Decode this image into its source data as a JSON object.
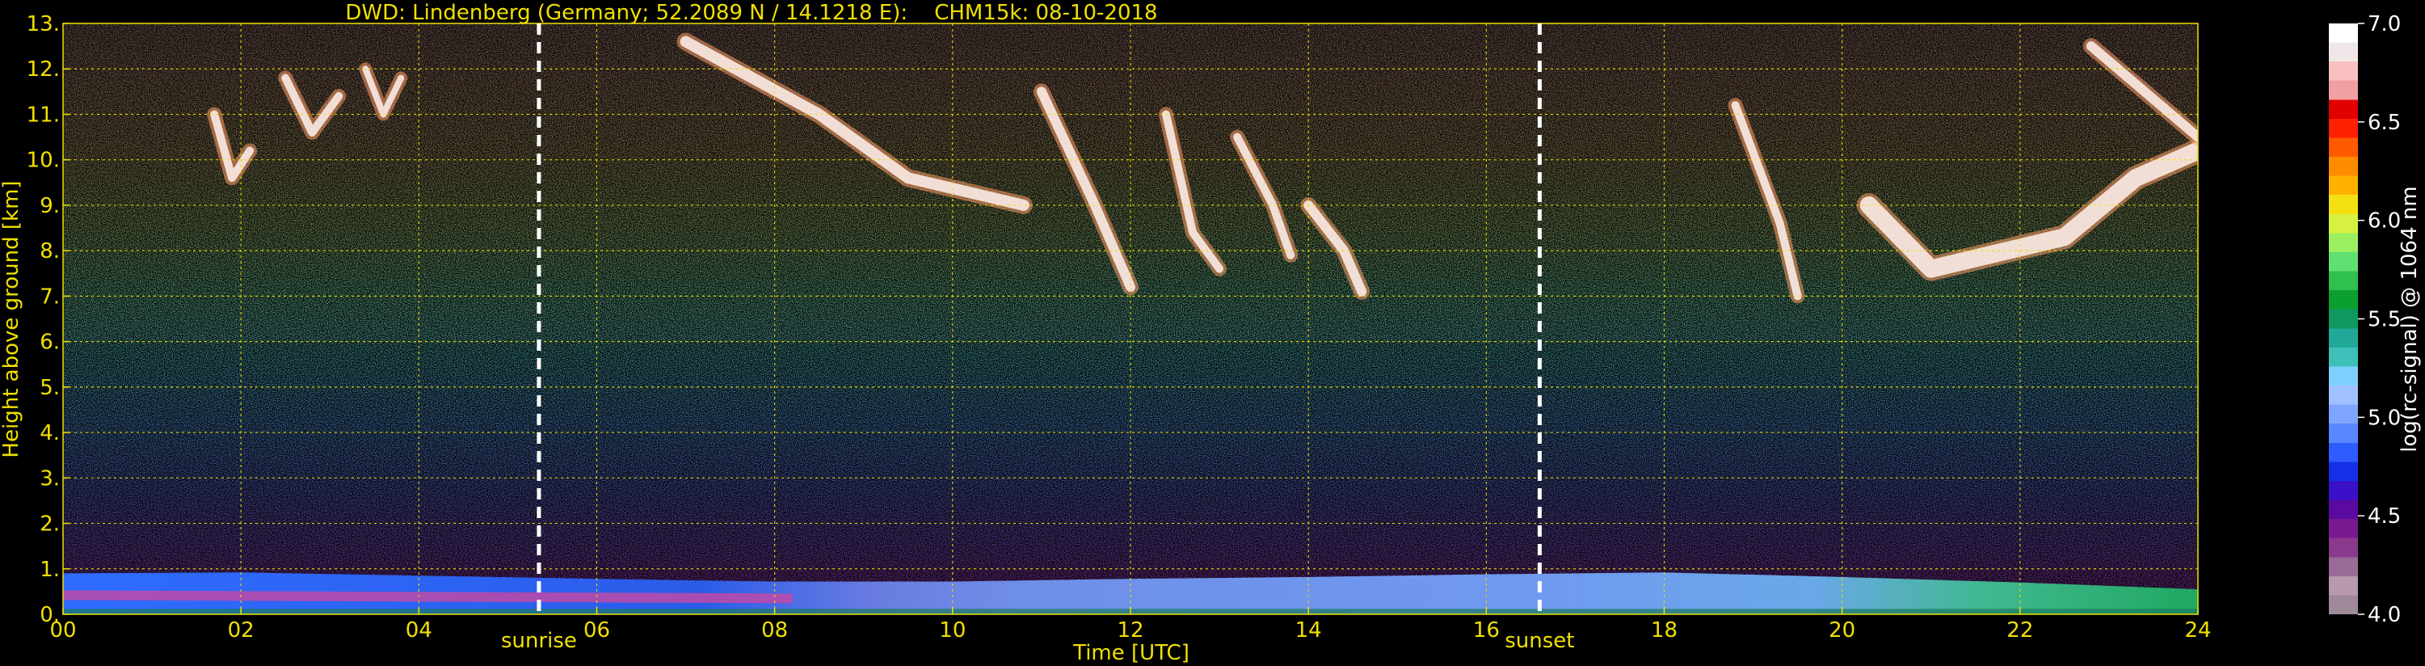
{
  "chart_data": {
    "type": "heatmap",
    "title": "DWD: Lindenberg (Germany; 52.2089 N / 14.1218 E):    CHM15k: 08-10-2018",
    "xlabel": "Time [UTC]",
    "ylabel": "Height above ground [km]",
    "xlim": [
      0,
      24
    ],
    "ylim": [
      0,
      13
    ],
    "x_ticks": [
      0,
      2,
      4,
      6,
      8,
      10,
      12,
      14,
      16,
      18,
      20,
      22,
      24
    ],
    "x_tick_labels": [
      "00",
      "02",
      "04",
      "06",
      "08",
      "10",
      "12",
      "14",
      "16",
      "18",
      "20",
      "22",
      "24"
    ],
    "y_ticks": [
      0,
      1,
      2,
      3,
      4,
      5,
      6,
      7,
      8,
      9,
      10,
      11,
      12,
      13
    ],
    "y_tick_labels": [
      "0.",
      "1.",
      "2.",
      "3.",
      "4.",
      "5.",
      "6.",
      "7.",
      "8.",
      "9.",
      "10.",
      "11.",
      "12.",
      "13."
    ],
    "grid": true,
    "annotations": [
      {
        "label": "sunrise",
        "x": 5.35
      },
      {
        "label": "sunset",
        "x": 16.6
      }
    ],
    "colorbar": {
      "label": "log(rc-signal) @ 1064 nm",
      "range": [
        4.0,
        7.0
      ],
      "ticks": [
        4.0,
        4.5,
        5.0,
        5.5,
        6.0,
        6.5,
        7.0
      ],
      "tick_labels": [
        "4.0",
        "4.5",
        "5.0",
        "5.5",
        "6.0",
        "6.5",
        "7.0"
      ],
      "colors": [
        "#a08a9a",
        "#b89aac",
        "#9a6a98",
        "#8a3a8c",
        "#7a1890",
        "#5a0aa0",
        "#3a10c8",
        "#1530e8",
        "#2e5cff",
        "#5a86ff",
        "#7ea6ff",
        "#a0c0ff",
        "#7ed0ff",
        "#3ec0b8",
        "#20a898",
        "#0f9860",
        "#0aa030",
        "#30c050",
        "#60e070",
        "#9aee60",
        "#d8f040",
        "#f4e010",
        "#ffb000",
        "#ff8c00",
        "#ff5a00",
        "#ff2000",
        "#e00000",
        "#f0a0a0",
        "#f8c0c0",
        "#f0e8e8",
        "#ffffff"
      ]
    },
    "features": {
      "boundary_layer": [
        [
          0,
          0.9
        ],
        [
          2,
          0.92
        ],
        [
          4,
          0.85
        ],
        [
          6,
          0.78
        ],
        [
          8,
          0.72
        ],
        [
          10,
          0.72
        ],
        [
          12,
          0.78
        ],
        [
          14,
          0.82
        ],
        [
          16,
          0.88
        ],
        [
          18,
          0.92
        ],
        [
          20,
          0.82
        ],
        [
          22,
          0.7
        ],
        [
          24,
          0.55
        ]
      ],
      "cloud_base": [
        [
          1.9,
          9.6
        ],
        [
          4.6,
          11.0
        ],
        [
          7.5,
          10.9
        ],
        [
          9.2,
          9.5
        ],
        [
          10.5,
          9.0
        ],
        [
          12.0,
          7.2
        ],
        [
          13.5,
          8.0
        ],
        [
          14.6,
          7.1
        ],
        [
          19.3,
          7.0
        ],
        [
          21.0,
          7.5
        ],
        [
          22.5,
          8.2
        ],
        [
          23.2,
          9.4
        ],
        [
          24,
          10.2
        ]
      ]
    }
  }
}
